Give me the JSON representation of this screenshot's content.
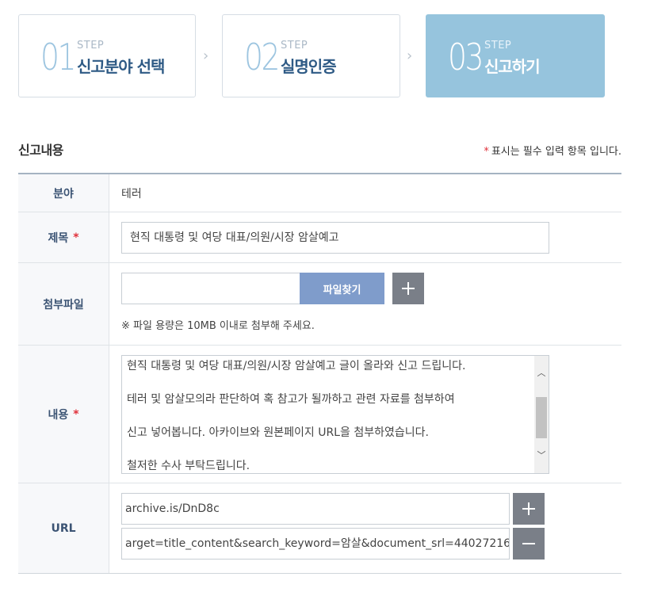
{
  "steps": [
    {
      "num": "01",
      "label": "STEP",
      "title": "신고분야 선택",
      "active": false
    },
    {
      "num": "02",
      "label": "STEP",
      "title": "실명인증",
      "active": false
    },
    {
      "num": "03",
      "label": "STEP",
      "title": "신고하기",
      "active": true
    }
  ],
  "section": {
    "title": "신고내용",
    "required_star": "*",
    "required_note": "표시는 필수 입력 항목 입니다."
  },
  "form": {
    "category": {
      "label": "분야",
      "value": "테러"
    },
    "subject": {
      "label": "제목",
      "required": "*",
      "value": "현직 대통령 및 여당 대표/의원/시장 암살예고"
    },
    "attachment": {
      "label": "첨부파일",
      "file_value": "",
      "find_button": "파일찾기",
      "add_icon": "plus-icon",
      "note": "※ 파일 용량은 10MB 이내로 첨부해 주세요."
    },
    "content": {
      "label": "내용",
      "required": "*",
      "lines": [
        "현직 대통령 및 여당 대표/의원/시장 암살예고 글이 올라와 신고 드립니다.",
        "테러 및 암살모의라 판단하여 혹 참고가 될까하고 관련 자료를 첨부하여",
        "신고 넣어봅니다. 아카이브와 원본페이지 URL을 첨부하였습니다.",
        "철저한 수사 부탁드립니다."
      ]
    },
    "url": {
      "label": "URL",
      "values": [
        "archive.is/DnD8c",
        "arget=title_content&search_keyword=암살&document_srl=44027216"
      ],
      "add_icon": "plus-icon",
      "remove_icon": "minus-icon"
    }
  },
  "colors": {
    "active_step_bg": "#96c4dd",
    "step_title": "#2e5a85",
    "find_button_bg": "#7f9ccb",
    "icon_button_bg": "#7a7f88",
    "required_star": "#e0303a"
  }
}
